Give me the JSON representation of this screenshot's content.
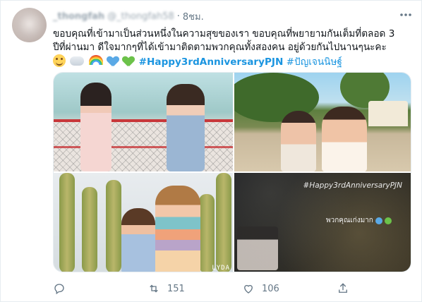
{
  "tweet": {
    "display_name": "_thongfah",
    "handle": "@_thongfah58",
    "separator": "·",
    "time": "8ชม.",
    "more_icon": "more-horizontal-icon",
    "text_line1": "ขอบคุณที่เข้ามาเป็นส่วนหนึ่งในความสุขของเรา ขอบคุณที่พยายามกันเต็มที่ตลอด 3",
    "text_line2": "ปีที่ผ่านมา ดีใจมากๆที่ได้เข้ามาติดตามพวกคุณทั้งสองคน อยู่ด้วยกันไปนานๆนะคะ",
    "emojis": [
      "smiling-face-emoji",
      "cloud-emoji",
      "rainbow-emoji",
      "blue-heart-emoji",
      "green-heart-emoji"
    ],
    "hashtag1": "#Happy3rdAnniversaryPJN",
    "hashtag2": "#ปัญเจนนิษฐ์"
  },
  "media": {
    "photos": [
      {
        "name": "photo-two-girls-fence"
      },
      {
        "name": "photo-selfie-beach"
      },
      {
        "name": "photo-cactus-garden",
        "watermark": "LYDA"
      },
      {
        "name": "photo-dark-card",
        "tag": "#Happy3rdAnniversaryPJN",
        "caption": "พวกคุณเก่งมาก"
      }
    ]
  },
  "actions": {
    "reply_icon": "reply-icon",
    "retweet_icon": "retweet-icon",
    "retweet_count": "151",
    "like_icon": "like-heart-icon",
    "like_count": "106",
    "share_icon": "share-icon"
  },
  "colors": {
    "link": "#1b95e0",
    "secondary": "#657786",
    "border": "#e6ecf0"
  }
}
